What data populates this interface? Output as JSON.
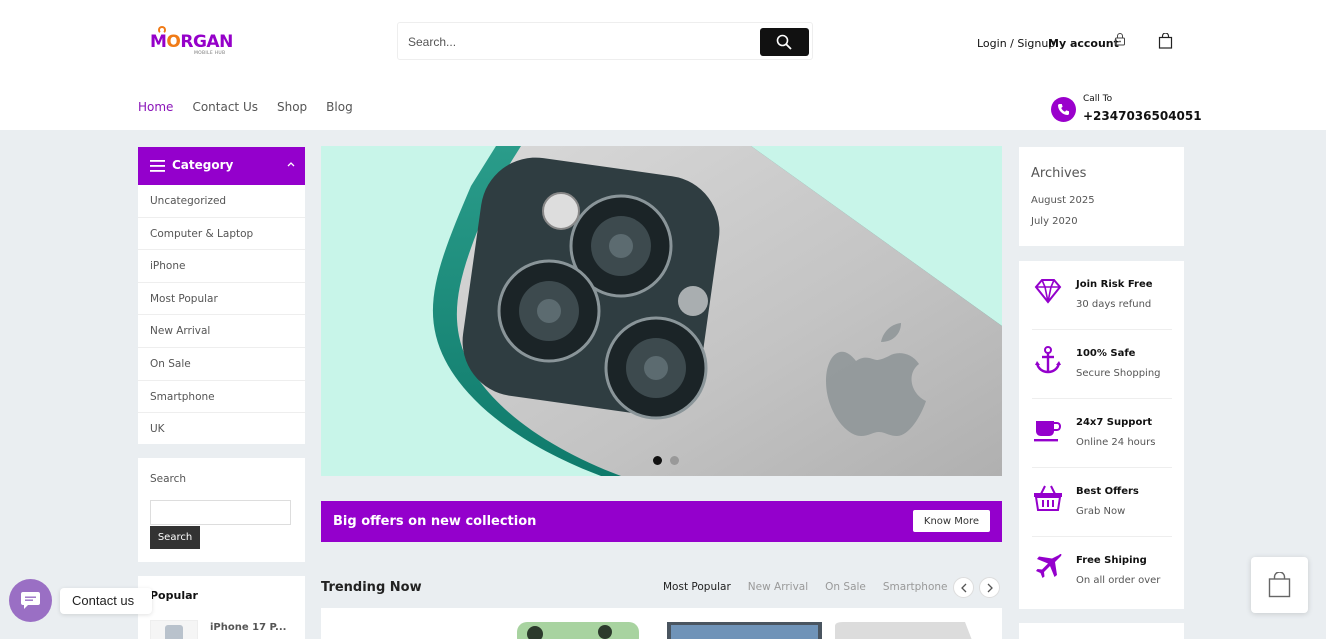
{
  "brand": {
    "logo_text_pre": "M",
    "logo_text_o": "O",
    "logo_text_post": "RGAN",
    "logo_sub": "MOBILE HUB"
  },
  "header": {
    "search_placeholder": "Search...",
    "login_label": "Login / Signup",
    "account_label": "My account"
  },
  "nav": {
    "items": [
      "Home",
      "Contact Us",
      "Shop",
      "Blog"
    ]
  },
  "call": {
    "label": "Call To",
    "number": "+2347036504051"
  },
  "category": {
    "title": "Category",
    "items": [
      "Uncategorized",
      "Computer & Laptop",
      "iPhone",
      "Most Popular",
      "New Arrival",
      "On Sale",
      "Smartphone",
      "UK"
    ]
  },
  "search_widget": {
    "label": "Search",
    "button": "Search"
  },
  "popular_widget": {
    "title": "Popular",
    "item_name": "iPhone 17 P..."
  },
  "offer_bar": {
    "text": "Big offers on new collection",
    "button": "Know More"
  },
  "trending": {
    "title": "Trending Now",
    "tabs": [
      "Most Popular",
      "New Arrival",
      "On Sale",
      "Smartphone"
    ]
  },
  "archives": {
    "title": "Archives",
    "items": [
      "August 2025",
      "July 2020"
    ]
  },
  "features": [
    {
      "title": "Join Risk Free",
      "subtitle": "30 days refund",
      "icon": "diamond-icon"
    },
    {
      "title": "100% Safe",
      "subtitle": "Secure Shopping",
      "icon": "anchor-icon"
    },
    {
      "title": "24x7 Support",
      "subtitle": "Online 24 hours",
      "icon": "coffee-cup-icon"
    },
    {
      "title": "Best Offers",
      "subtitle": "Grab Now",
      "icon": "basket-icon"
    },
    {
      "title": "Free Shiping",
      "subtitle": "On all order over",
      "icon": "plane-icon"
    }
  ],
  "chat": {
    "label": "Contact us"
  },
  "colors": {
    "accent": "#9400cc",
    "hero_bg": "#c8f5e9",
    "page_bg": "#eaeef1"
  }
}
